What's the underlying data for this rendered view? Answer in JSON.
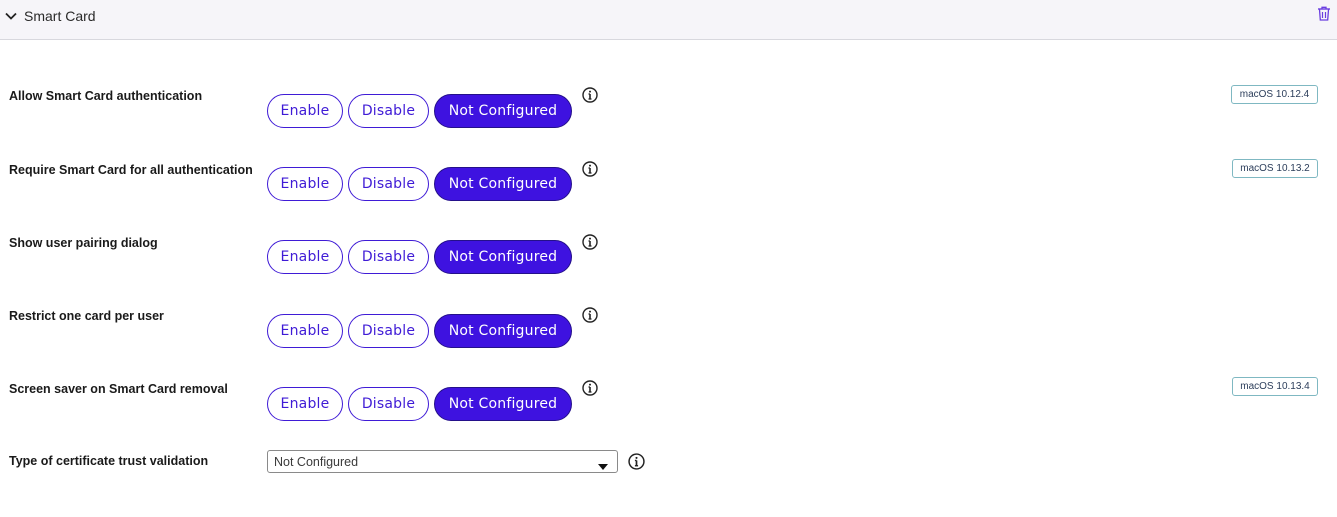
{
  "section": {
    "title": "Smart Card",
    "collapse_icon": "chevron-down-icon",
    "delete_icon": "trash-icon"
  },
  "options": {
    "enable": "Enable",
    "disable": "Disable",
    "not_configured": "Not Configured"
  },
  "settings": [
    {
      "label": "Allow Smart Card authentication",
      "selected": "Not Configured",
      "badge": "macOS 10.12.4"
    },
    {
      "label": "Require Smart Card for all authentication",
      "selected": "Not Configured",
      "badge": "macOS 10.13.2"
    },
    {
      "label": "Show user pairing dialog",
      "selected": "Not Configured",
      "badge": ""
    },
    {
      "label": "Restrict one card per user",
      "selected": "Not Configured",
      "badge": ""
    },
    {
      "label": "Screen saver on Smart Card removal",
      "selected": "Not Configured",
      "badge": "macOS 10.13.4"
    }
  ],
  "trust_validation": {
    "label": "Type of certificate trust validation",
    "value": "Not Configured"
  },
  "colors": {
    "accent": "#3e12e0",
    "badge_border": "#7fb8c2",
    "header_bg": "#f6f5f9"
  }
}
